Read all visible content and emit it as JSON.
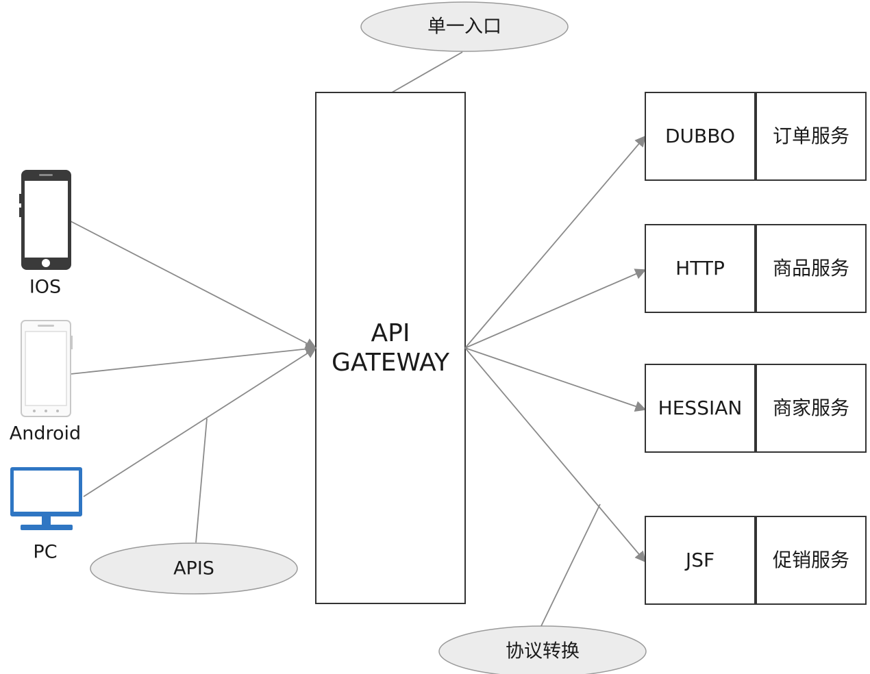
{
  "gateway": {
    "line1": "API",
    "line2": "GATEWAY"
  },
  "clients": {
    "ios": "IOS",
    "android": "Android",
    "pc": "PC"
  },
  "annotations": {
    "single_entry": "单一入口",
    "apis": "APIS",
    "protocol_conversion": "协议转换"
  },
  "services": [
    {
      "protocol": "DUBBO",
      "name": "订单服务"
    },
    {
      "protocol": "HTTP",
      "name": "商品服务"
    },
    {
      "protocol": "HESSIAN",
      "name": "商家服务"
    },
    {
      "protocol": "JSF",
      "name": "促销服务"
    }
  ],
  "colors": {
    "line": "#8a8a8a",
    "box_stroke": "#333333",
    "ellipse_fill": "#ececec",
    "pc_icon": "#2f76c3",
    "phone_dark": "#3a3a3a"
  }
}
